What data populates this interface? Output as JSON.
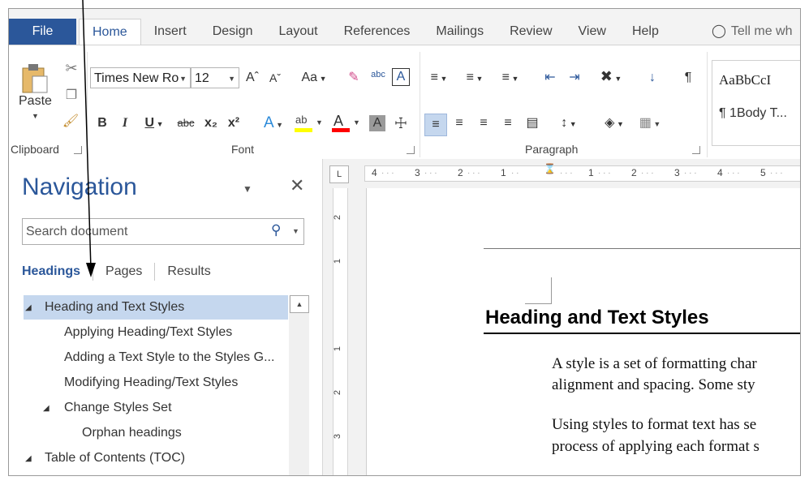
{
  "ribbon_tabs": {
    "file": "File",
    "items": [
      "Home",
      "Insert",
      "Design",
      "Layout",
      "References",
      "Mailings",
      "Review",
      "View",
      "Help"
    ],
    "active": "Home",
    "tell_me": "Tell me wh"
  },
  "clipboard": {
    "paste": "Paste",
    "group_label": "Clipboard"
  },
  "font": {
    "name": "Times New Ro",
    "size": "12",
    "group_label": "Font",
    "case_label": "Aa",
    "bold": "B",
    "italic": "I",
    "underline": "U",
    "strike": "abc",
    "sub": "x₂",
    "sup": "x²",
    "highlight_color": "#ffff00",
    "font_color": "#ff0000"
  },
  "paragraph": {
    "group_label": "Paragraph"
  },
  "styles": {
    "style1": "AaBbCcI",
    "style2": "¶ 1Body T..."
  },
  "navigation": {
    "title": "Navigation",
    "search_placeholder": "Search document",
    "tabs": [
      "Headings",
      "Pages",
      "Results"
    ],
    "active_tab": "Headings",
    "headings": [
      {
        "text": "Heading and Text Styles",
        "level": 1,
        "expanded": true,
        "selected": true
      },
      {
        "text": "Applying Heading/Text Styles",
        "level": 2
      },
      {
        "text": "Adding a Text Style to the Styles G...",
        "level": 2
      },
      {
        "text": "Modifying Heading/Text Styles",
        "level": 2
      },
      {
        "text": "Change Styles Set",
        "level": 2,
        "expanded": true
      },
      {
        "text": "Orphan headings",
        "level": 3
      },
      {
        "text": "Table of Contents (TOC)",
        "level": 1,
        "expanded": true
      }
    ]
  },
  "ruler": {
    "h_labels": [
      "4",
      "3",
      "2",
      "1",
      "1",
      "2",
      "3",
      "4",
      "5"
    ],
    "v_labels": [
      "2",
      "1",
      "1",
      "2",
      "3"
    ],
    "tab_selector": "L"
  },
  "document": {
    "heading": "Heading and Text Styles",
    "p1_line1": "A style is a set of formatting char",
    "p1_line2": "alignment and spacing. Some sty",
    "p2_line1": "Using styles to format text has se",
    "p2_line2": "process of applying each format s"
  },
  "colors": {
    "accent": "#2b579a",
    "selected_row": "#c5d7ee"
  }
}
